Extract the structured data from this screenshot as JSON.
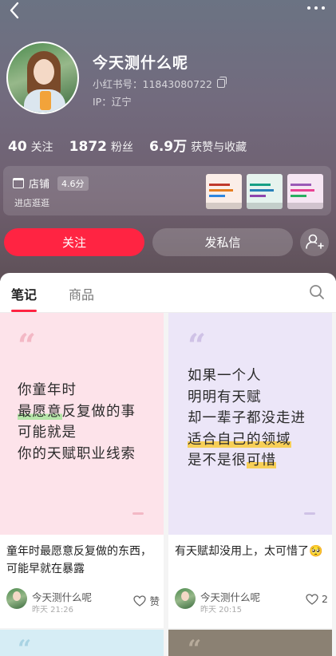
{
  "profile": {
    "username": "今天测什么呢",
    "red_id": "小红书号：11843080722",
    "ip": "IP：辽宁"
  },
  "stats": [
    {
      "num": "40",
      "label": "关注"
    },
    {
      "num": "1872",
      "label": "粉丝"
    },
    {
      "num": "6.9万",
      "label": "获赞与收藏"
    }
  ],
  "shop": {
    "label": "店铺",
    "score": "4.6分",
    "enter": "进店逛逛"
  },
  "actions": {
    "follow": "关注",
    "message": "发私信"
  },
  "tabs": [
    {
      "label": "笔记"
    },
    {
      "label": "商品"
    }
  ],
  "notes": [
    {
      "cover_lines": [
        "你童年时",
        "最愿意反复做的事",
        "可能就是",
        "你的天赋职业线索"
      ],
      "highlight": "最愿意",
      "title": "童年时最愿意反复做的东西，可能早就在暴露",
      "author": "今天测什么呢",
      "time": "昨天 21:26",
      "likes": "赞"
    },
    {
      "cover_lines": [
        "如果一个人",
        "明明有天赋",
        "却一辈子都没走进",
        "适合自己的领域",
        "是不是很可惜"
      ],
      "highlight": "可惜",
      "title": "有天赋却没用上，太可惜了🥺",
      "author": "今天测什么呢",
      "time": "昨天 20:15",
      "likes": "2"
    }
  ],
  "colors": {
    "accent": "#ff2442",
    "hero_gradient_top": "#6b7383",
    "hero_gradient_bottom": "#5e5057",
    "cover_pink": "#fde3ea",
    "cover_purple": "#ece6f8",
    "highlight_green": "#b6e6a9",
    "highlight_yellow": "#f7cf57"
  },
  "icons": [
    "back-arrow-icon",
    "more-dots-icon",
    "copy-icon",
    "shop-icon",
    "add-friend-icon",
    "search-icon",
    "heart-icon"
  ]
}
